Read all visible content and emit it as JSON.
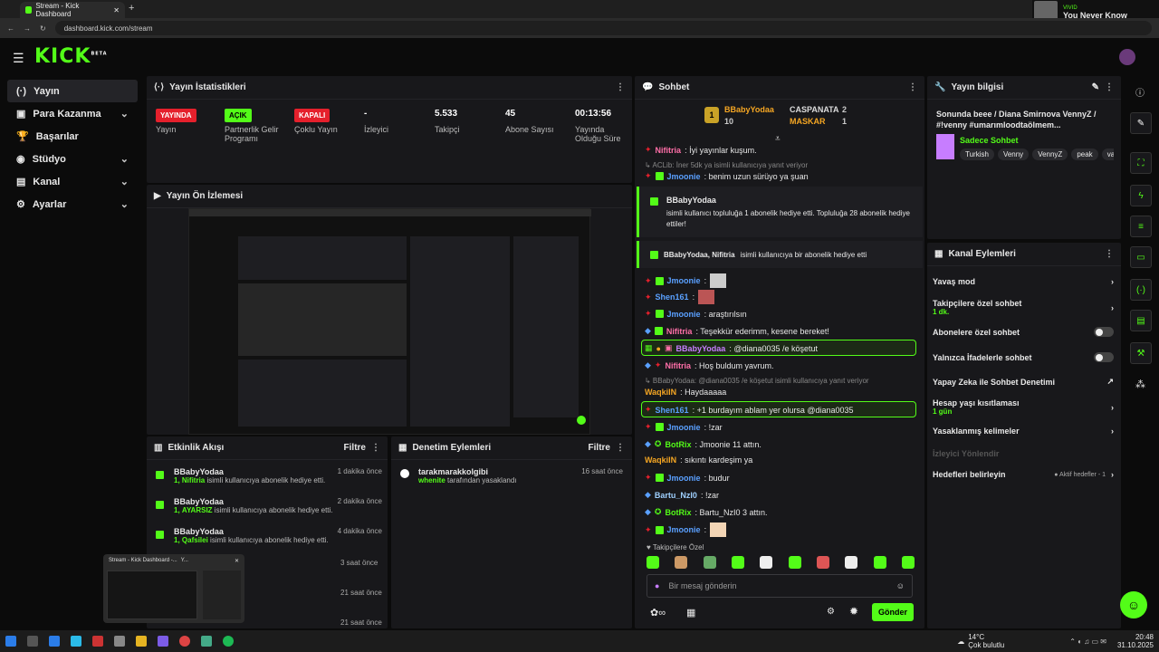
{
  "browser": {
    "tab_title": "Stream - Kick Dashboard",
    "url": "dashboard.kick.com/stream"
  },
  "media": {
    "artist": "VIVID",
    "song": "You Never Know"
  },
  "logo": "KICK",
  "logo_beta": "BETA",
  "sidebar": {
    "items": [
      {
        "label": "Yayın",
        "icon": "(·)"
      },
      {
        "label": "Para Kazanma"
      },
      {
        "label": "Başarılar"
      },
      {
        "label": "Stüdyo"
      },
      {
        "label": "Kanal"
      },
      {
        "label": "Ayarlar"
      }
    ]
  },
  "stats": {
    "title": "Yayın İstatistikleri",
    "items": [
      {
        "badge": "YAYINDA",
        "label": "Yayın"
      },
      {
        "badge": "AÇIK",
        "label": "Partnerlik Gelir Programı"
      },
      {
        "badge": "KAPALI",
        "label": "Çoklu Yayın"
      },
      {
        "value": "-",
        "label": "İzleyici"
      },
      {
        "value": "5.533",
        "label": "Takipçi"
      },
      {
        "value": "45",
        "label": "Abone Sayısı"
      },
      {
        "value": "00:13:56",
        "label": "Yayında Olduğu Süre"
      }
    ]
  },
  "preview": {
    "title": "Yayın Ön İzlemesi"
  },
  "activity": {
    "title": "Etkinlik Akışı",
    "filter": "Filtre",
    "items": [
      {
        "user": "BBabyYodaa",
        "detail_count": "1,",
        "detail_user": "Nifitria",
        "detail": "isimli kullanıcıya abonelik hediye etti.",
        "time": "1 dakika önce"
      },
      {
        "user": "BBabyYodaa",
        "detail_count": "1,",
        "detail_user": "AYARSIZ",
        "detail": "isimli kullanıcıya abonelik hediye etti.",
        "time": "2 dakika önce"
      },
      {
        "user": "BBabyYodaa",
        "detail_count": "1,",
        "detail_user": "Qafsilei",
        "detail": "isimli kullanıcıya abonelik hediye etti.",
        "time": "4 dakika önce"
      },
      {
        "time": "3 saat önce"
      },
      {
        "time": "21 saat önce"
      },
      {
        "time": "21 saat önce"
      }
    ]
  },
  "moderation": {
    "title": "Denetim Eylemleri",
    "filter": "Filtre",
    "user": "tarakmarakkolgibi",
    "by": "whenite",
    "action": "tarafından yasaklandı",
    "time": "16 saat önce"
  },
  "thumb": {
    "title": "Stream - Kick Dashboard -...",
    "title2": "Y..."
  },
  "chat": {
    "title": "Sohbet",
    "leaders": [
      {
        "rank": "1",
        "name": "BBabyYodaa",
        "count": "10"
      },
      {
        "rank": "",
        "name": "CASPANATA",
        "count": "2"
      },
      {
        "rank": "",
        "name": "MASKAR",
        "count": "1"
      }
    ],
    "msgs": [
      {
        "user": "Nifitria",
        "text": ": İyi yayınlar kuşum."
      },
      {
        "reply": "↳ ACLib: İner 5dk ya isimli kullanıcıya yanıt veriyor"
      },
      {
        "user": "Jmoonie",
        "text": ": benim uzun sürüyo ya şuan"
      },
      {
        "user": "Jmoonie",
        "text": ":"
      },
      {
        "user": "Shen161",
        "text": ":"
      },
      {
        "user": "Jmoonie",
        "text": ": araştırılsın"
      },
      {
        "user": "Nifitria",
        "text": ": Teşekkür ederimm, kesene bereket!"
      },
      {
        "user": "BBabyYodaa",
        "text": ": @diana0035 /e köşetut"
      },
      {
        "user": "Nifitria",
        "text": ": Hoş buldum yavrum."
      },
      {
        "reply": "↳ BBabyYodaa: @diana0035 /e köşetut isimli kullanıcıya yanıt veriyor"
      },
      {
        "user": "WaqkiIN",
        "text": ": Haydaaaaa"
      },
      {
        "user": "Shen161",
        "text": ": +1 burdayım ablam yer olursa @diana0035"
      },
      {
        "user": "Jmoonie",
        "text": ": !zar"
      },
      {
        "user": "BotRix",
        "text": ": Jmoonie 11 attın."
      },
      {
        "user": "WaqkiIN",
        "text": ": sıkıntı kardeşim ya"
      },
      {
        "user": "Jmoonie",
        "text": ": budur"
      },
      {
        "user": "Bartu_NzI0",
        "text": ": !zar"
      },
      {
        "user": "BotRix",
        "text": ": Bartu_NzI0 3 attın."
      },
      {
        "user": "Jmoonie",
        "text": ":"
      }
    ],
    "gift1_user": "BBabyYodaa",
    "gift1_text": "isimli kullanıcı topluluğa 1 abonelik hediye etti. Topluluğa 28 abonelik hediye ettiler!",
    "gift2_user": "BBabyYodaa, Nifitria",
    "gift2_text": "isimli kullanıcıya bir abonelik hediye etti",
    "emote_label": "Takipçilere Özel",
    "placeholder": "Bir mesaj gönderin",
    "send": "Gönder"
  },
  "info": {
    "title": "Yayın bilgisi",
    "stream_title": "Sonunda beee / Diana Smirnova VennyZ / #!venny #umarımloodtaölmem...",
    "category": "Sadece Sohbet",
    "tags": [
      "Turkish",
      "Venny",
      "VennyZ",
      "peak",
      "va"
    ]
  },
  "actions": {
    "title": "Kanal Eylemleri",
    "rows": [
      {
        "label": "Yavaş mod",
        "type": "arrow"
      },
      {
        "label": "Takipçilere özel sohbet",
        "sub": "1 dk.",
        "type": "arrow"
      },
      {
        "label": "Abonelere özel sohbet",
        "type": "toggle"
      },
      {
        "label": "Yalnızca İfadelerle sohbet",
        "type": "toggle"
      },
      {
        "label": "Yapay Zeka ile Sohbet Denetimi",
        "type": "ext"
      },
      {
        "label": "Hesap yaşı kısıtlaması",
        "sub": "1 gün",
        "type": "arrow"
      },
      {
        "label": "Yasaklanmış kelimeler",
        "type": "arrow"
      },
      {
        "label": "İzleyici Yönlendir",
        "type": "none"
      },
      {
        "label": "Hedefleri belirleyin",
        "type": "arrow",
        "extra": "● Aktif hedefler - 1"
      }
    ]
  },
  "taskbar": {
    "weather": "14°C",
    "weather_desc": "Çok bulutlu",
    "time": "20:48",
    "date": "31.10.2025"
  }
}
